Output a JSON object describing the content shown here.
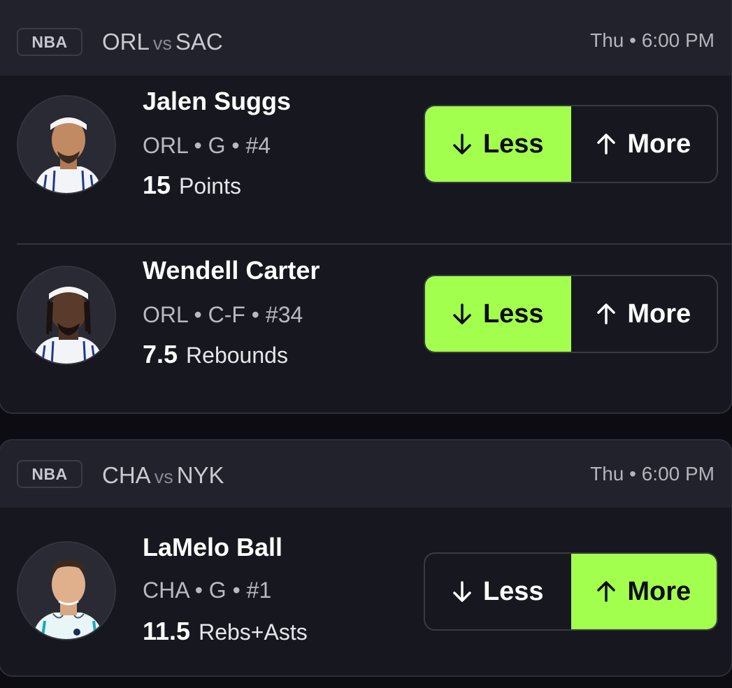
{
  "colors": {
    "background": "#0c0c12",
    "card": "#171720",
    "card_header": "#22222c",
    "selected_pick": "#a3ff4d"
  },
  "games": [
    {
      "league": "NBA",
      "home": "ORL",
      "vs": "vs",
      "away": "SAC",
      "time": "Thu • 6:00 PM",
      "players": [
        {
          "name": "Jalen Suggs",
          "meta": "ORL • G • #4",
          "line_value": "15",
          "line_stat": "Points",
          "avatar_icon": "player-headshot",
          "less_label": "Less",
          "more_label": "More",
          "selected": "less"
        },
        {
          "name": "Wendell Carter",
          "meta": "ORL • C-F • #34",
          "line_value": "7.5",
          "line_stat": "Rebounds",
          "avatar_icon": "player-headshot",
          "less_label": "Less",
          "more_label": "More",
          "selected": "less"
        }
      ]
    },
    {
      "league": "NBA",
      "home": "CHA",
      "vs": "vs",
      "away": "NYK",
      "time": "Thu • 6:00 PM",
      "players": [
        {
          "name": "LaMelo Ball",
          "meta": "CHA • G • #1",
          "line_value": "11.5",
          "line_stat": "Rebs+Asts",
          "avatar_icon": "player-headshot",
          "less_label": "Less",
          "more_label": "More",
          "selected": "more"
        }
      ]
    }
  ]
}
